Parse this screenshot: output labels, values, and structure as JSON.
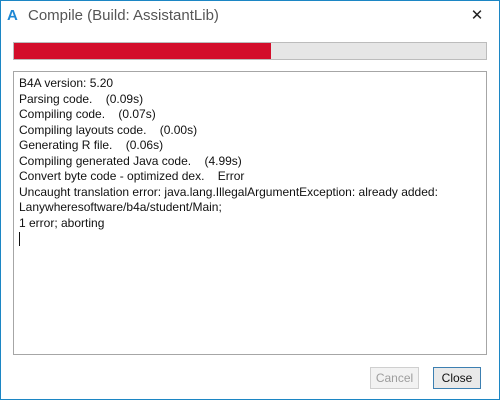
{
  "window": {
    "title": "Compile (Build: AssistantLib)",
    "app_icon_glyph": "A",
    "close_glyph": "✕"
  },
  "progress": {
    "fraction": 0.545,
    "fill_color": "#d30e2b",
    "track_color": "#e6e6e6"
  },
  "log": {
    "lines": [
      "B4A version: 5.20",
      "Parsing code.    (0.09s)",
      "Compiling code.    (0.07s)",
      "Compiling layouts code.    (0.00s)",
      "Generating R file.    (0.06s)",
      "Compiling generated Java code.    (4.99s)",
      "Convert byte code - optimized dex.    Error",
      "Uncaught translation error: java.lang.IllegalArgumentException: already added:",
      "Lanywheresoftware/b4a/student/Main;",
      "1 error; aborting"
    ]
  },
  "buttons": {
    "cancel_label": "Cancel",
    "close_label": "Close"
  },
  "colors": {
    "window_border": "#1c86c4",
    "accent": "#1e88d4",
    "default_button_border": "#3c7fb1"
  }
}
